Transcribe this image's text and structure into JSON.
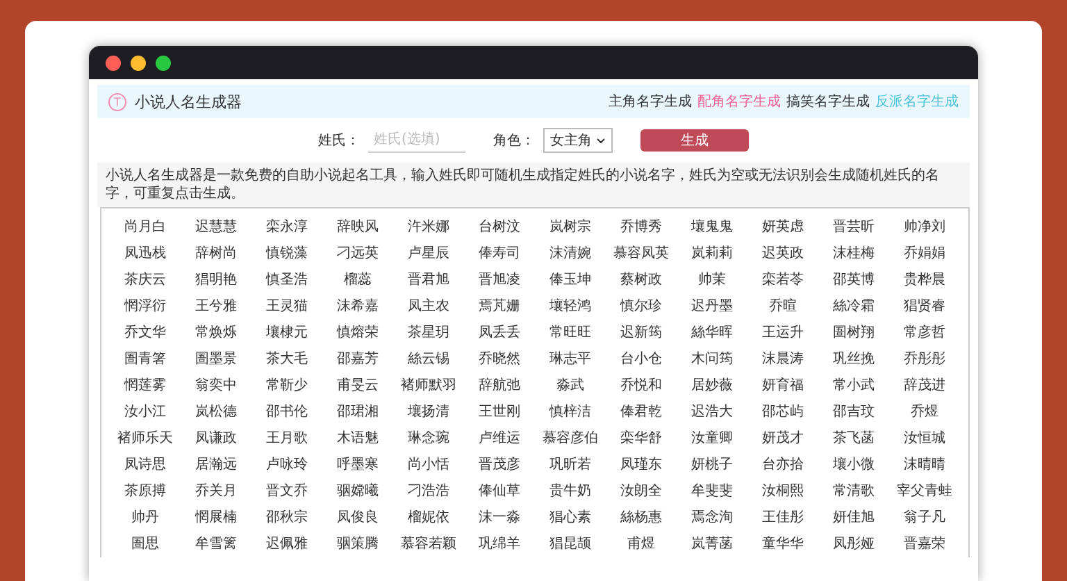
{
  "header": {
    "logo": "T",
    "title": "小说人名生成器",
    "links": [
      {
        "label": "主角名字生成",
        "color": "#333333"
      },
      {
        "label": "配角名字生成",
        "color": "#f06292"
      },
      {
        "label": "搞笑名字生成",
        "color": "#333333"
      },
      {
        "label": "反派名字生成",
        "color": "#4fc3d9"
      }
    ]
  },
  "form": {
    "surname": {
      "label": "姓氏：",
      "placeholder": "姓氏(选填)"
    },
    "role": {
      "label": "角色：",
      "value": "女主角"
    },
    "button": "生成"
  },
  "description": "小说人名生成器是一款免费的自助小说起名工具，输入姓氏即可随机生成指定姓氏的小说名字，姓氏为空或无法识别会生成随机姓氏的名字，可重复点击生成。",
  "names": [
    [
      "尚月白",
      "迟慧慧",
      "栾永淳",
      "辞映风",
      "汻米娜",
      "台树汶",
      "岚树宗",
      "乔博秀",
      "壤鬼鬼",
      "妍英虑",
      "晋芸昕",
      "帅净刘"
    ],
    [
      "凤迅栈",
      "辞树尚",
      "慎锐藻",
      "刁远英",
      "卢星辰",
      "俸寿司",
      "沫清婉",
      "慕容凤英",
      "岚莉莉",
      "迟英政",
      "沫桂梅",
      "乔娟娟"
    ],
    [
      "茶庆云",
      "猖明艳",
      "慎圣浩",
      "榴蕊",
      "晋君旭",
      "晋旭凌",
      "俸玉坤",
      "蔡树政",
      "帅茉",
      "栾若苓",
      "邵英博",
      "贵桦晨"
    ],
    [
      "惘浮衍",
      "王兮雅",
      "王灵猫",
      "沫希嘉",
      "凤主农",
      "焉芃姗",
      "壤轻鸿",
      "慎尔珍",
      "迟丹墨",
      "乔暄",
      "絲冷霜",
      "猖贤睿"
    ],
    [
      "乔文华",
      "常焕烁",
      "壤棣元",
      "慎熔荣",
      "茶星玥",
      "凤丢丢",
      "常旺旺",
      "迟新筠",
      "絲华晖",
      "王运升",
      "圄树翔",
      "常彦哲"
    ],
    [
      "圄青箸",
      "圄墨景",
      "茶大毛",
      "邵嘉芳",
      "絲云锡",
      "乔晓然",
      "琳志平",
      "台小仓",
      "木问筠",
      "沫晨涛",
      "巩丝挽",
      "乔彤彤"
    ],
    [
      "惘莲雾",
      "翁奕中",
      "常靳少",
      "甫旻云",
      "褚师默羽",
      "辞航弛",
      "淼武",
      "乔悦和",
      "居妙薇",
      "妍育福",
      "常小武",
      "辞茂进"
    ],
    [
      "汝小江",
      "岚松德",
      "邵书伦",
      "邵珺湘",
      "壤扬清",
      "王世刚",
      "慎梓洁",
      "俸君乾",
      "迟浩大",
      "邵芯屿",
      "邵吉玟",
      "乔煜"
    ],
    [
      "褚师乐天",
      "凤谦政",
      "王月歌",
      "木语魅",
      "琳念琬",
      "卢维运",
      "慕容彦伯",
      "栾华舒",
      "汝童卿",
      "妍茂才",
      "茶飞菡",
      "汝恒城"
    ],
    [
      "凤诗思",
      "居瀚远",
      "卢咏玲",
      "呼墨寒",
      "尚小恬",
      "晋茂彦",
      "巩昕若",
      "凤瑾东",
      "妍桃子",
      "台亦拾",
      "壤小微",
      "沫晴晴"
    ],
    [
      "茶原搏",
      "乔关月",
      "晋文乔",
      "骃嫦曦",
      "刁浩浩",
      "俸仙草",
      "贵牛奶",
      "汝朗全",
      "牟斐斐",
      "汝桐熙",
      "常清歌",
      "宰父青蛙"
    ],
    [
      "帅丹",
      "惘展楠",
      "邵秋宗",
      "凤俊良",
      "榴妮依",
      "沫一淼",
      "猖心素",
      "絲杨惠",
      "焉念洵",
      "王佳彤",
      "妍佳旭",
      "翁子凡"
    ],
    [
      "圄思",
      "牟雪篱",
      "迟佩雅",
      "骃策腾",
      "慕容若颖",
      "巩绵羊",
      "猖昆颉",
      "甫煜",
      "岚菁菡",
      "童华华",
      "凤彤娅",
      "晋嘉荣"
    ]
  ]
}
